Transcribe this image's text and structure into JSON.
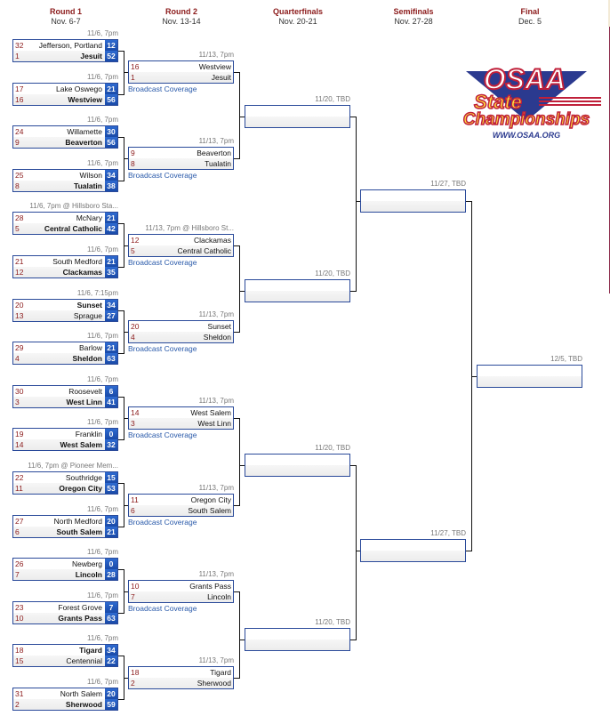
{
  "rounds": [
    {
      "name": "Round 1",
      "dates": "Nov. 6-7"
    },
    {
      "name": "Round 2",
      "dates": "Nov. 13-14"
    },
    {
      "name": "Quarterfinals",
      "dates": "Nov. 20-21"
    },
    {
      "name": "Semifinals",
      "dates": "Nov. 27-28"
    },
    {
      "name": "Final",
      "dates": "Dec. 5"
    }
  ],
  "logo": {
    "line1": "OSAA",
    "line2": "State",
    "line3": "Championships",
    "url": "WWW.OSAA.ORG"
  },
  "broadcast_label": "Broadcast Coverage",
  "round1": [
    {
      "time": "11/6, 7pm",
      "t1": {
        "seed": "32",
        "name": "Jefferson, Portland",
        "score": "12",
        "win": false
      },
      "t2": {
        "seed": "1",
        "name": "Jesuit",
        "score": "52",
        "win": true
      }
    },
    {
      "time": "11/6, 7pm",
      "t1": {
        "seed": "17",
        "name": "Lake Oswego",
        "score": "21",
        "win": false
      },
      "t2": {
        "seed": "16",
        "name": "Westview",
        "score": "56",
        "win": true
      }
    },
    {
      "time": "11/6, 7pm",
      "t1": {
        "seed": "24",
        "name": "Willamette",
        "score": "30",
        "win": false
      },
      "t2": {
        "seed": "9",
        "name": "Beaverton",
        "score": "56",
        "win": true
      }
    },
    {
      "time": "11/6, 7pm",
      "t1": {
        "seed": "25",
        "name": "Wilson",
        "score": "34",
        "win": false
      },
      "t2": {
        "seed": "8",
        "name": "Tualatin",
        "score": "38",
        "win": true
      }
    },
    {
      "time": "11/6, 7pm @ Hillsboro Sta...",
      "t1": {
        "seed": "28",
        "name": "McNary",
        "score": "21",
        "win": false
      },
      "t2": {
        "seed": "5",
        "name": "Central Catholic",
        "score": "42",
        "win": true
      }
    },
    {
      "time": "11/6, 7pm",
      "t1": {
        "seed": "21",
        "name": "South Medford",
        "score": "21",
        "win": false
      },
      "t2": {
        "seed": "12",
        "name": "Clackamas",
        "score": "35",
        "win": true
      }
    },
    {
      "time": "11/6, 7:15pm",
      "t1": {
        "seed": "20",
        "name": "Sunset",
        "score": "34",
        "win": true
      },
      "t2": {
        "seed": "13",
        "name": "Sprague",
        "score": "27",
        "win": false
      }
    },
    {
      "time": "11/6, 7pm",
      "t1": {
        "seed": "29",
        "name": "Barlow",
        "score": "21",
        "win": false
      },
      "t2": {
        "seed": "4",
        "name": "Sheldon",
        "score": "63",
        "win": true
      }
    },
    {
      "time": "11/6, 7pm",
      "t1": {
        "seed": "30",
        "name": "Roosevelt",
        "score": "6",
        "win": false
      },
      "t2": {
        "seed": "3",
        "name": "West Linn",
        "score": "41",
        "win": true
      }
    },
    {
      "time": "11/6, 7pm",
      "t1": {
        "seed": "19",
        "name": "Franklin",
        "score": "0",
        "win": false
      },
      "t2": {
        "seed": "14",
        "name": "West Salem",
        "score": "32",
        "win": true
      }
    },
    {
      "time": "11/6, 7pm @ Pioneer Mem...",
      "t1": {
        "seed": "22",
        "name": "Southridge",
        "score": "15",
        "win": false
      },
      "t2": {
        "seed": "11",
        "name": "Oregon City",
        "score": "53",
        "win": true
      }
    },
    {
      "time": "11/6, 7pm",
      "t1": {
        "seed": "27",
        "name": "North Medford",
        "score": "20",
        "win": false
      },
      "t2": {
        "seed": "6",
        "name": "South Salem",
        "score": "21",
        "win": true
      }
    },
    {
      "time": "11/6, 7pm",
      "t1": {
        "seed": "26",
        "name": "Newberg",
        "score": "0",
        "win": false
      },
      "t2": {
        "seed": "7",
        "name": "Lincoln",
        "score": "28",
        "win": true
      }
    },
    {
      "time": "11/6, 7pm",
      "t1": {
        "seed": "23",
        "name": "Forest Grove",
        "score": "7",
        "win": false
      },
      "t2": {
        "seed": "10",
        "name": "Grants Pass",
        "score": "63",
        "win": true
      }
    },
    {
      "time": "11/6, 7pm",
      "t1": {
        "seed": "18",
        "name": "Tigard",
        "score": "34",
        "win": true
      },
      "t2": {
        "seed": "15",
        "name": "Centennial",
        "score": "22",
        "win": false
      }
    },
    {
      "time": "11/6, 7pm",
      "t1": {
        "seed": "31",
        "name": "North Salem",
        "score": "20",
        "win": false
      },
      "t2": {
        "seed": "2",
        "name": "Sherwood",
        "score": "59",
        "win": true
      }
    }
  ],
  "round2": [
    {
      "time": "11/13, 7pm",
      "t1": {
        "seed": "16",
        "name": "Westview"
      },
      "t2": {
        "seed": "1",
        "name": "Jesuit"
      },
      "broadcast": true
    },
    {
      "time": "11/13, 7pm",
      "t1": {
        "seed": "9",
        "name": "Beaverton"
      },
      "t2": {
        "seed": "8",
        "name": "Tualatin"
      },
      "broadcast": true
    },
    {
      "time": "11/13, 7pm @ Hillsboro St...",
      "t1": {
        "seed": "12",
        "name": "Clackamas"
      },
      "t2": {
        "seed": "5",
        "name": "Central Catholic"
      },
      "broadcast": true
    },
    {
      "time": "11/13, 7pm",
      "t1": {
        "seed": "20",
        "name": "Sunset"
      },
      "t2": {
        "seed": "4",
        "name": "Sheldon"
      },
      "broadcast": true
    },
    {
      "time": "11/13, 7pm",
      "t1": {
        "seed": "14",
        "name": "West Salem"
      },
      "t2": {
        "seed": "3",
        "name": "West Linn"
      },
      "broadcast": true
    },
    {
      "time": "11/13, 7pm",
      "t1": {
        "seed": "11",
        "name": "Oregon City"
      },
      "t2": {
        "seed": "6",
        "name": "South Salem"
      },
      "broadcast": true
    },
    {
      "time": "11/13, 7pm",
      "t1": {
        "seed": "10",
        "name": "Grants Pass"
      },
      "t2": {
        "seed": "7",
        "name": "Lincoln"
      },
      "broadcast": true
    },
    {
      "time": "11/13, 7pm",
      "t1": {
        "seed": "18",
        "name": "Tigard"
      },
      "t2": {
        "seed": "2",
        "name": "Sherwood"
      },
      "broadcast": false
    }
  ],
  "quarterfinals": [
    {
      "time": "11/20, TBD"
    },
    {
      "time": "11/20, TBD"
    },
    {
      "time": "11/20, TBD"
    },
    {
      "time": "11/20, TBD"
    }
  ],
  "semifinals": [
    {
      "time": "11/27, TBD"
    },
    {
      "time": "11/27, TBD"
    }
  ],
  "final": [
    {
      "time": "12/5, TBD"
    }
  ],
  "colors": {
    "accent_blue": "#2a4a9a",
    "score_blue": "#1f55b8",
    "seed_maroon": "#8b1a1a",
    "broadcast_link": "#2a5aaa"
  }
}
